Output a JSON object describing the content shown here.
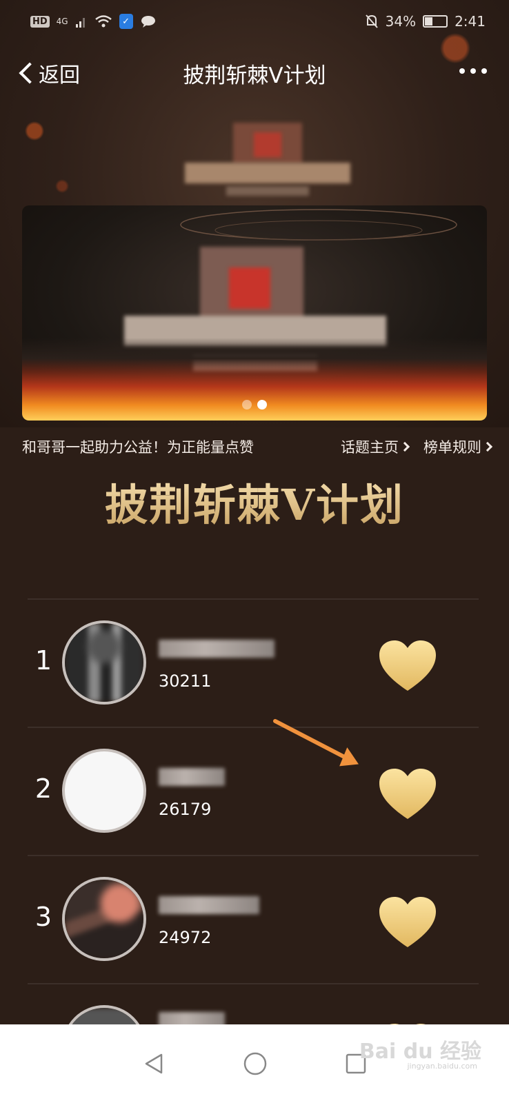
{
  "status_bar": {
    "hd": "HD",
    "network": "4G",
    "battery_percent_text": "34%",
    "battery_level": 0.34,
    "time": "2:41"
  },
  "nav": {
    "back_label": "返回",
    "title": "披荆斩棘V计划",
    "more_icon": "more-dots-icon"
  },
  "topic": {
    "description": "和哥哥一起助力公益！为正能量点赞",
    "home_link": "话题主页",
    "rules_link": "榜单规则"
  },
  "banner": {
    "slide_count": 2,
    "active_slide": 2
  },
  "list_title": "披荆斩棘V计划",
  "ranking": [
    {
      "rank": "1",
      "score": "30211",
      "like_icon": "heart-icon"
    },
    {
      "rank": "2",
      "score": "26179",
      "like_icon": "heart-icon"
    },
    {
      "rank": "3",
      "score": "24972",
      "like_icon": "heart-icon"
    }
  ],
  "colors": {
    "background": "#2c1e17",
    "heart_top": "#fbe3a0",
    "heart_bottom": "#e2b860",
    "arrow": "#f0923d",
    "title_gold": "#e9c98a"
  },
  "watermark": {
    "brand": "Bai du 经验",
    "url": "jingyan.baidu.com"
  }
}
